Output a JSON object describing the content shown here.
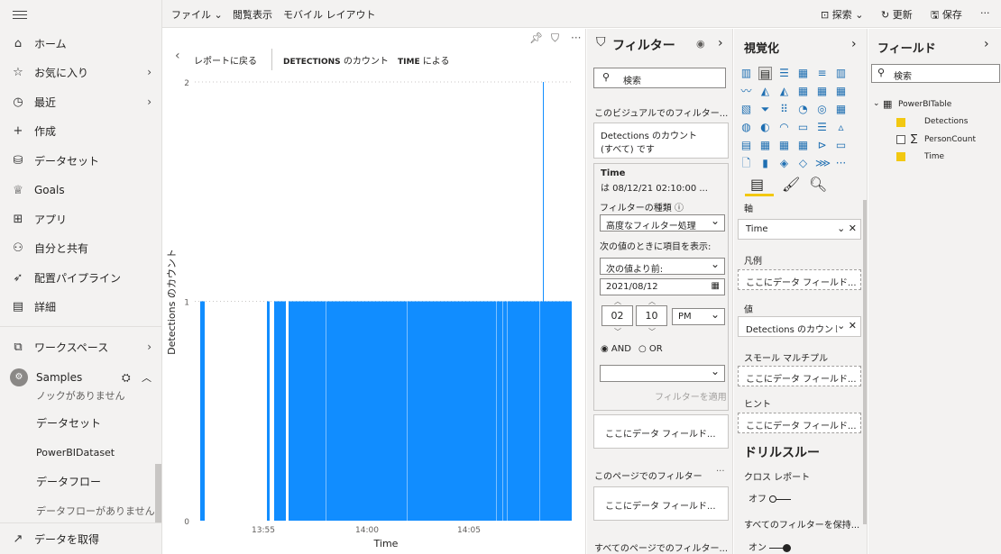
{
  "nav": {
    "items": [
      {
        "label": "ホーム",
        "icon": "home-icon"
      },
      {
        "label": "お気に入り",
        "icon": "star-icon",
        "chevron": true
      },
      {
        "label": "最近",
        "icon": "clock-icon",
        "chevron": true
      },
      {
        "label": "作成",
        "icon": "plus-icon"
      },
      {
        "label": "データセット",
        "icon": "database-icon"
      },
      {
        "label": "Goals",
        "icon": "trophy-icon"
      },
      {
        "label": "アプリ",
        "icon": "apps-icon"
      },
      {
        "label": "自分と共有",
        "icon": "share-icon"
      },
      {
        "label": "配置パイプライン",
        "icon": "rocket-icon"
      },
      {
        "label": "詳細",
        "icon": "book-icon"
      }
    ],
    "workspaces": "ワークスペース",
    "samples": "Samples",
    "sub_items": [
      "ノックがありません",
      "データセット",
      "PowerBIDataset",
      "データフロー",
      "データフローがありません"
    ],
    "get_data": "データを取得"
  },
  "topbar": {
    "file": "ファイル",
    "view": "閲覧表示",
    "mobile": "モバイル レイアウト",
    "search": "探索",
    "refresh": "更新",
    "save": "保存",
    "more": "···"
  },
  "report": {
    "back": "レポートに戻る",
    "title_bold": "DETECTIONS",
    "title_rest": "のカウント",
    "by_bold": "TIME",
    "by_rest": "による"
  },
  "chart_data": {
    "type": "bar",
    "ylabel": "Detections のカウント",
    "xlabel": "Time",
    "y_ticks": [
      "2",
      "1",
      "0"
    ],
    "x_ticks": [
      "13:55",
      "14:00",
      "14:05"
    ],
    "ylim": [
      0,
      2
    ],
    "bars": [
      [
        222,
        227,
        1
      ],
      [
        296,
        299,
        1
      ],
      [
        304,
        317,
        1
      ],
      [
        320,
        602,
        1
      ],
      [
        602,
        603,
        2
      ],
      [
        603,
        634,
        1
      ]
    ],
    "gaps": [
      361,
      451,
      550,
      557,
      562,
      598
    ],
    "colors": {
      "bar": "#118dff"
    }
  },
  "filters": {
    "title": "フィルター",
    "search": "検索",
    "visual_section": "このビジュアルでのフィルター...",
    "card1_line1": "Detections のカウント",
    "card1_line2": "(すべて) です",
    "card2_title": "Time",
    "card2_sub": "は 08/12/21 02:10:00 ...",
    "type_label": "フィルターの種類",
    "type_value": "高度なフィルター処理",
    "show_label": "次の値のときに項目を表示:",
    "cond_value": "次の値より前:",
    "date_value": "2021/08/12",
    "hour": "02",
    "minute": "10",
    "ampm": "PM",
    "and": "AND",
    "or": "OR",
    "apply": "フィルターを適用",
    "add_field": "ここにデータ フィールド...",
    "page_section": "このページでのフィルター",
    "page_add": "ここにデータ フィールド...",
    "all_section": "すべてのページでのフィルター..."
  },
  "viz": {
    "title": "視覚化",
    "axis_label": "軸",
    "axis_value": "Time",
    "legend_label": "凡例",
    "legend_add": "ここにデータ フィールド...",
    "value_label": "値",
    "value_value": "Detections のカウント",
    "sm_label": "スモール マルチプル",
    "sm_add": "ここにデータ フィールド...",
    "hint_label": "ヒント",
    "hint_add": "ここにデータ フィールド...",
    "drill_title": "ドリルスルー",
    "cross_label": "クロス レポート",
    "off": "オフ",
    "keep_label": "すべてのフィルターを保持...",
    "on": "オン",
    "more": "···"
  },
  "fields": {
    "title": "フィールド",
    "search": "検索",
    "table": "PowerBITable",
    "items": [
      {
        "name": "Detections",
        "checked": true,
        "sigma": false
      },
      {
        "name": "PersonCount",
        "checked": false,
        "sigma": true
      },
      {
        "name": "Time",
        "checked": true,
        "sigma": false
      }
    ]
  }
}
